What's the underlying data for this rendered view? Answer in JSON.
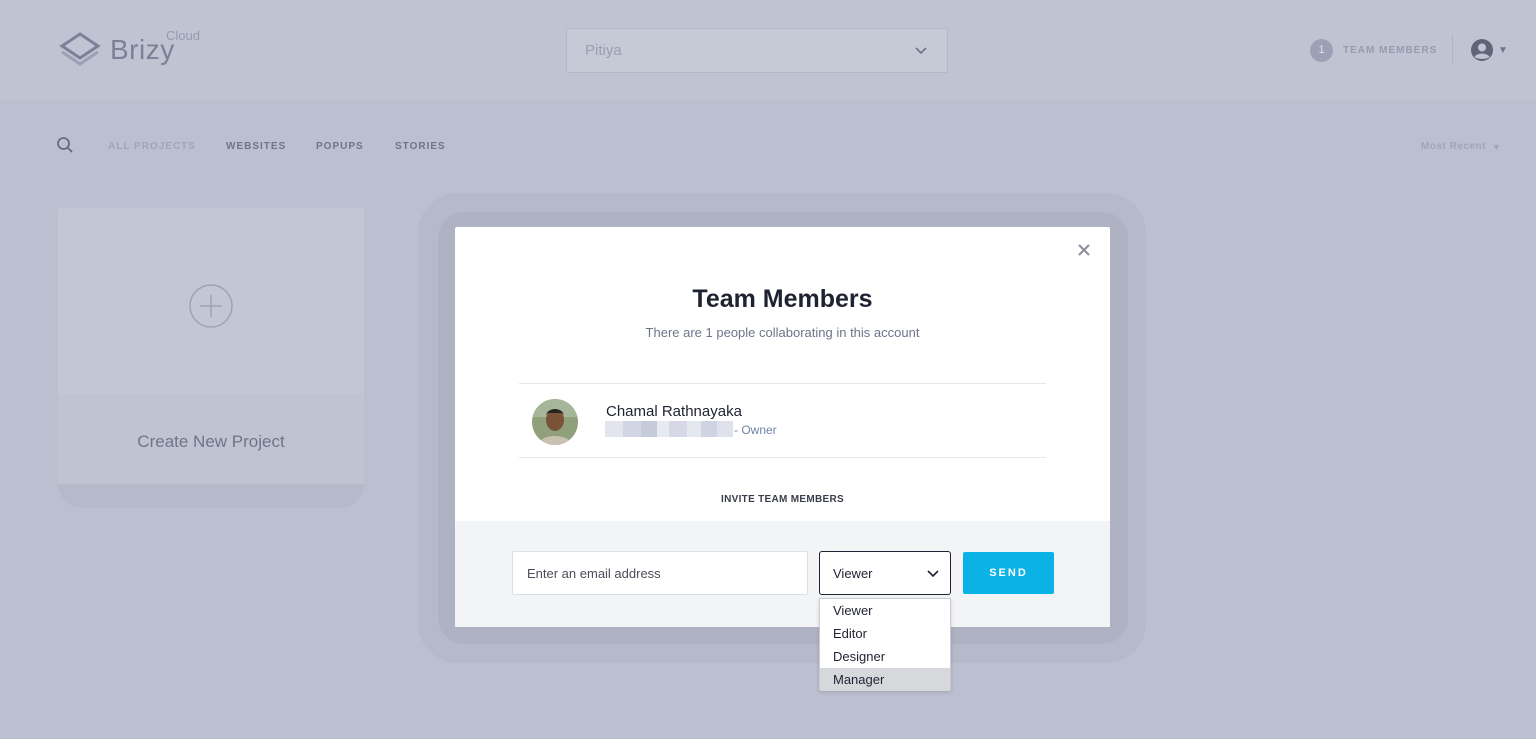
{
  "header": {
    "logo_text": "Brizy",
    "logo_sub": "Cloud",
    "project_value": "Pitiya",
    "team_count": "1",
    "team_label": "TEAM MEMBERS"
  },
  "filters": {
    "tabs": [
      "ALL PROJECTS",
      "WEBSITES",
      "POPUPS",
      "STORIES"
    ],
    "active_tab": "ALL PROJECTS",
    "sort_label": "Most Recent"
  },
  "create_card": {
    "label": "Create New Project"
  },
  "modal": {
    "title": "Team Members",
    "subtitle": "There are 1 people collaborating in this account",
    "members": [
      {
        "name": "Chamal Rathnayaka",
        "role": "- Owner"
      }
    ],
    "invite_heading": "INVITE TEAM MEMBERS",
    "email_placeholder": "Enter an email address",
    "role_selected": "Viewer",
    "send_label": "SEND"
  },
  "role_dropdown": {
    "options": [
      "Viewer",
      "Editor",
      "Designer",
      "Manager"
    ],
    "highlighted": "Manager"
  },
  "colors": {
    "accent": "#0ab2e6",
    "backdrop": "#bbbfcf"
  }
}
